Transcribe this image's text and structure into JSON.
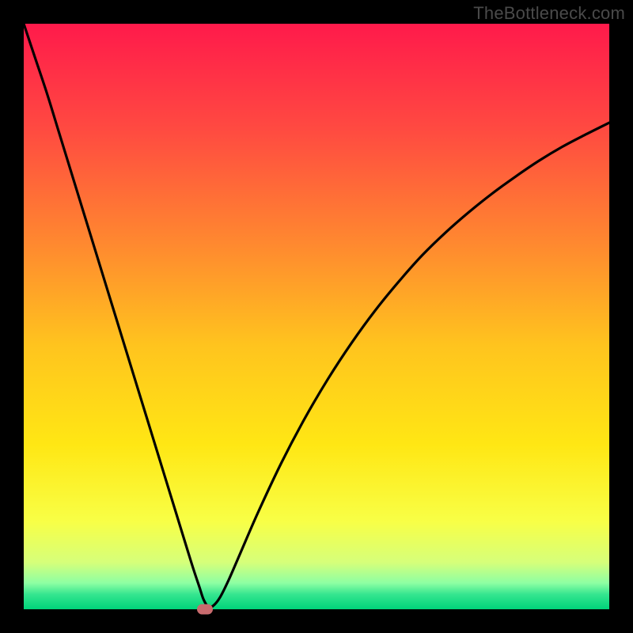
{
  "watermark": "TheBottleneck.com",
  "chart_data": {
    "type": "line",
    "title": "",
    "xlabel": "",
    "ylabel": "",
    "xlim": [
      0,
      100
    ],
    "ylim": [
      0,
      100
    ],
    "grid": false,
    "background_gradient_stops": [
      {
        "offset": 0.0,
        "color": "#ff1a4b"
      },
      {
        "offset": 0.18,
        "color": "#ff4a41"
      },
      {
        "offset": 0.38,
        "color": "#ff8a2f"
      },
      {
        "offset": 0.55,
        "color": "#ffc41e"
      },
      {
        "offset": 0.72,
        "color": "#ffe714"
      },
      {
        "offset": 0.85,
        "color": "#f8ff46"
      },
      {
        "offset": 0.92,
        "color": "#d6ff7a"
      },
      {
        "offset": 0.955,
        "color": "#8effa3"
      },
      {
        "offset": 0.975,
        "color": "#34e58f"
      },
      {
        "offset": 1.0,
        "color": "#00d37a"
      }
    ],
    "series": [
      {
        "name": "bottleneck-curve",
        "x": [
          0.0,
          2.0,
          4.0,
          6.0,
          8.0,
          10.0,
          12.0,
          14.0,
          16.0,
          18.0,
          20.0,
          22.0,
          24.0,
          26.0,
          28.0,
          29.0,
          30.0,
          30.7,
          31.5,
          32.3,
          33.5,
          35.0,
          37.0,
          40.0,
          44.0,
          48.0,
          52.0,
          56.0,
          60.0,
          64.0,
          68.0,
          72.0,
          76.0,
          80.0,
          84.0,
          88.0,
          92.0,
          96.0,
          100.0
        ],
        "y": [
          100.0,
          94.0,
          88.0,
          81.5,
          75.0,
          68.5,
          62.0,
          55.5,
          49.0,
          42.5,
          36.0,
          29.5,
          23.0,
          16.5,
          10.0,
          6.8,
          3.8,
          1.7,
          0.45,
          0.55,
          2.0,
          5.0,
          9.6,
          16.5,
          25.0,
          32.6,
          39.4,
          45.5,
          51.0,
          55.9,
          60.4,
          64.3,
          67.8,
          71.0,
          73.9,
          76.6,
          79.0,
          81.1,
          83.1
        ]
      }
    ],
    "marker": {
      "x": 31.0,
      "y": 0.0,
      "color": "#c96b6e"
    }
  }
}
